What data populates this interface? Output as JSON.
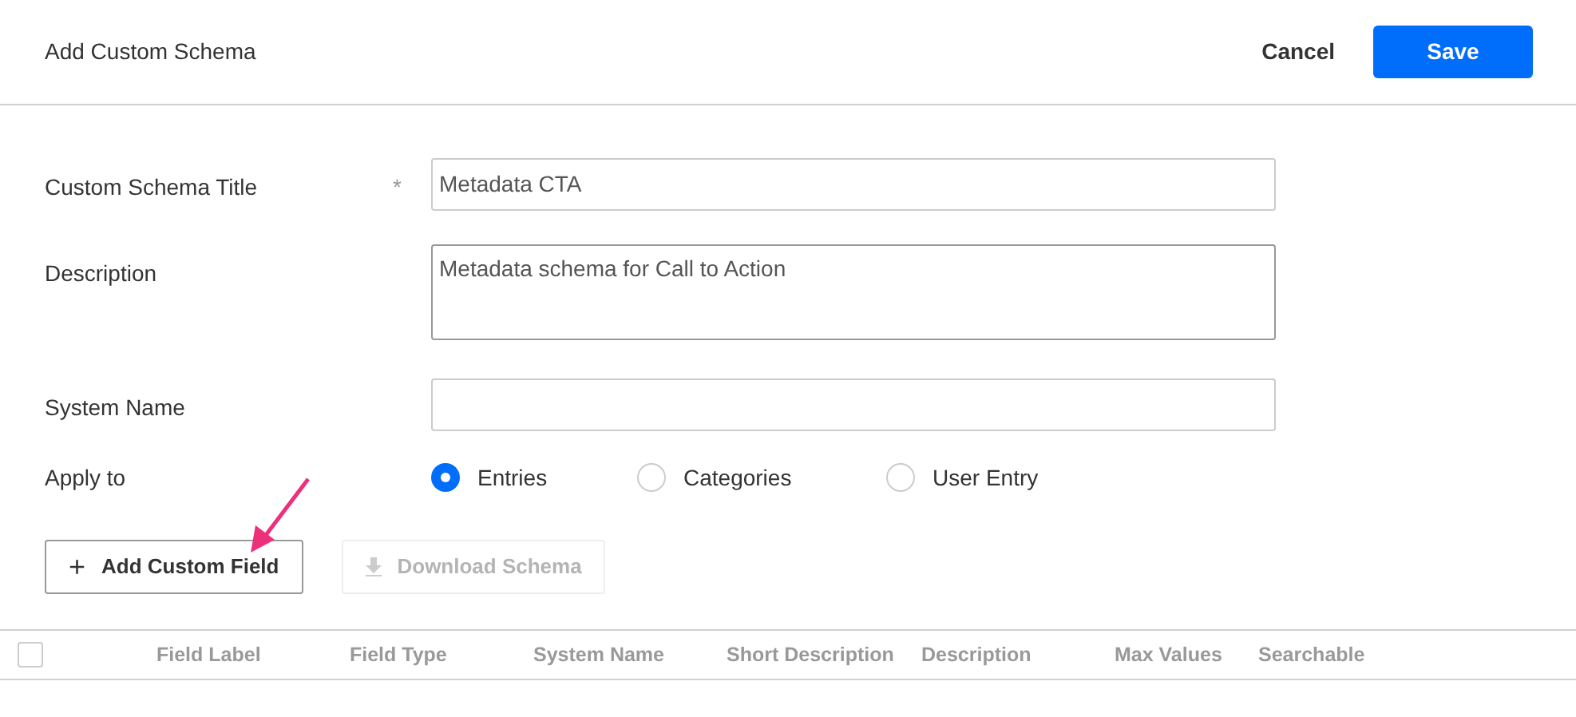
{
  "header": {
    "title": "Add Custom Schema",
    "cancel": "Cancel",
    "save": "Save"
  },
  "fields": [
    {
      "label": "Custom Schema Title",
      "required_mark": "*",
      "value": "Metadata CTA",
      "kind": "input"
    },
    {
      "label": "Description",
      "value": "Metadata schema for Call to Action",
      "kind": "textarea"
    },
    {
      "label": "System Name",
      "kind": "input"
    }
  ],
  "apply_to": {
    "label": "Apply to",
    "options": [
      {
        "label": "Entries",
        "selected": true
      },
      {
        "label": "Categories",
        "selected": false
      },
      {
        "label": "User Entry",
        "selected": false
      }
    ]
  },
  "actions": [
    {
      "label": "Add Custom Field",
      "icon": "+",
      "disabled": false
    },
    {
      "label": "Download Schema",
      "disabled": true
    }
  ],
  "table": {
    "select_all_checked": false,
    "columns": [
      "Field Label",
      "Field Type",
      "System Name",
      "Short Description",
      "Description",
      "Max Values",
      "Searchable"
    ]
  }
}
